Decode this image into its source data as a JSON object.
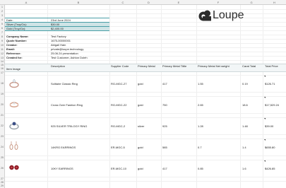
{
  "columns": [
    "A",
    "B",
    "C",
    "D",
    "E",
    "F",
    "G",
    "H"
  ],
  "rows": [
    "1",
    "2",
    "3",
    "4",
    "5",
    "6",
    "7",
    "8",
    "9",
    "10",
    "11",
    "12",
    "13",
    "14",
    "15",
    "16",
    "17",
    "18",
    "19",
    "20",
    "21",
    "22",
    "23",
    "24",
    "25",
    "26",
    "27",
    "28",
    "29",
    "30",
    "31",
    "32"
  ],
  "rates": {
    "date_label": "Date:",
    "date_value": "23rd June 2024",
    "silver_label": "Silver (Troy/Oz):",
    "silver_value": "$30.00",
    "gold_label": "Gold (Troy/Oz):",
    "gold_value": "$2,400.00"
  },
  "logo": {
    "text": "Loupe"
  },
  "quote_info": [
    {
      "label": "Company Name:",
      "value": "Test Factory"
    },
    {
      "label": "Quote Number:",
      "value": "1675-00000001"
    },
    {
      "label": "Creator:",
      "value": "Abigail Hain"
    },
    {
      "label": "Email:",
      "value": "private@loupe.technology"
    },
    {
      "label": "Reference:",
      "value": "25.06.24 presentation"
    },
    {
      "label": "Created for:",
      "value": "Test Customer, Ashton Doleh"
    }
  ],
  "table_headers": [
    "Item Image",
    "Description",
    "Supplier Code",
    "Primary Metal",
    "Primary Metal Tittle",
    "Primary Metal Net weight",
    "Carat Total",
    "Total Price"
  ],
  "items": [
    {
      "description": "Solitaire Classic Ring",
      "code": "RG-MGC-27",
      "metal": "gold",
      "title": "417",
      "weight": "1.55",
      "carat": "0.19",
      "price": "$126.71",
      "icon": "ring-icon"
    },
    {
      "description": "Cross Over Fashion Ring",
      "code": "RG-MGC-22",
      "metal": "gold",
      "title": "750",
      "weight": "2.65",
      "carat": "18.6",
      "price": "$17,529.24",
      "icon": "ring-icon"
    },
    {
      "description": "925 SILVER TRILOGY RING",
      "code": "RG-MGC-2",
      "metal": "silver",
      "title": "925",
      "weight": "1.28",
      "carat": "1.48",
      "price": "$39.00",
      "icon": "ring-icon"
    },
    {
      "description": "14KRG EARRINGS",
      "code": "ER-MGC-5",
      "metal": "gold",
      "title": "585",
      "weight": "0.7",
      "carat": "1.4",
      "price": "$655.80",
      "icon": "earring-icon"
    },
    {
      "description": "10KY EARRINGS",
      "code": "ER-MGC-10",
      "metal": "gold",
      "title": "417",
      "weight": "0.85",
      "carat": "1.6",
      "price": "$426.85",
      "icon": "earring-icon"
    }
  ],
  "colors": {
    "accent": "#4a9ea6",
    "highlight": "#cfe4e6",
    "logo": "#2b2b2b"
  }
}
